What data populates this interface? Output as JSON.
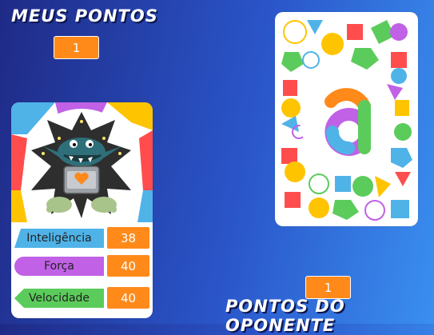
{
  "my_points": {
    "title": "MEUS PONTOS",
    "value": "1"
  },
  "opponent_points": {
    "title": "PONTOS DO OPONENTE",
    "value": "1"
  },
  "monster_card": {
    "stats": [
      {
        "label": "Inteligência",
        "value": "38",
        "color": "#4fb3e8",
        "shape": "arrow-left-tip"
      },
      {
        "label": "Força",
        "value": "40",
        "color": "#c061e6",
        "shape": "rounded-left"
      },
      {
        "label": "Velocidade",
        "value": "40",
        "color": "#5bcc5b",
        "shape": "arrow-left"
      }
    ]
  },
  "card_back": {
    "logo_letter": "a"
  },
  "colors": {
    "score_box": "#ff8a1a",
    "title_text": "#ffffff"
  }
}
